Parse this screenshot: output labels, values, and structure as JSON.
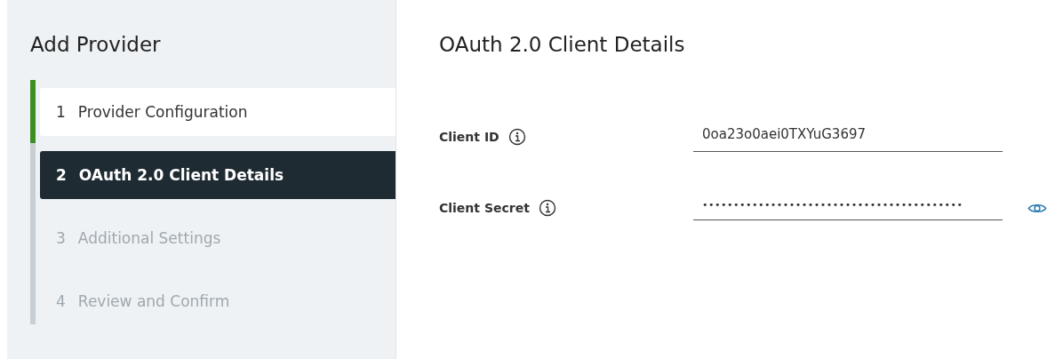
{
  "sidebar": {
    "title": "Add Provider",
    "steps": [
      {
        "number": "1",
        "label": "Provider Configuration",
        "completed": true,
        "selected": false,
        "disabled": false
      },
      {
        "number": "2",
        "label": "OAuth 2.0 Client Details",
        "completed": false,
        "selected": true,
        "disabled": false
      },
      {
        "number": "3",
        "label": "Additional Settings",
        "completed": false,
        "selected": false,
        "disabled": true
      },
      {
        "number": "4",
        "label": "Review and Confirm",
        "completed": false,
        "selected": false,
        "disabled": true
      }
    ]
  },
  "main": {
    "title": "OAuth 2.0 Client Details",
    "fields": [
      {
        "kind": "text",
        "label": "Client ID",
        "value": "0oa23o0aei0TXYuG3697"
      },
      {
        "kind": "password",
        "label": "Client Secret",
        "value": "••••••••••••••••••••••••••••••••••••••••••"
      }
    ]
  }
}
